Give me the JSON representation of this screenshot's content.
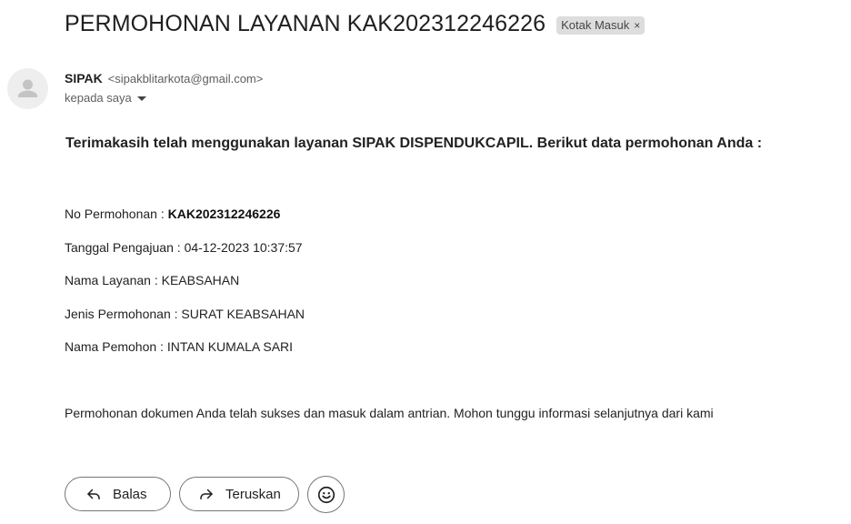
{
  "email": {
    "subject": "PERMOHONAN LAYANAN KAK202312246226",
    "label": "Kotak Masuk",
    "label_remove": "×",
    "sender_name": "SIPAK",
    "sender_email": "<sipakblitarkota@gmail.com>",
    "recipient": "kepada saya"
  },
  "body": {
    "intro": "Terimakasih telah menggunakan layanan SIPAK DISPENDUKCAPIL. Berikut data permohonan Anda :",
    "fields": [
      {
        "label": "No Permohonan : ",
        "value": "KAK202312246226"
      },
      {
        "label": "Tanggal Pengajuan : ",
        "value": "04-12-2023 10:37:57"
      },
      {
        "label": "Nama Layanan : ",
        "value": "KEABSAHAN"
      },
      {
        "label": "Jenis Permohonan : ",
        "value": "SURAT KEABSAHAN"
      },
      {
        "label": "Nama Pemohon : ",
        "value": "INTAN KUMALA SARI"
      }
    ],
    "note": "Permohonan dokumen Anda telah sukses dan masuk dalam antrian. Mohon tunggu informasi selanjutnya dari kami"
  },
  "actions": {
    "reply_label": "Balas",
    "forward_label": "Teruskan",
    "reply_icon": "reply-arrow-icon",
    "forward_icon": "forward-arrow-icon",
    "emoji_icon": "emoji-smile-icon"
  }
}
